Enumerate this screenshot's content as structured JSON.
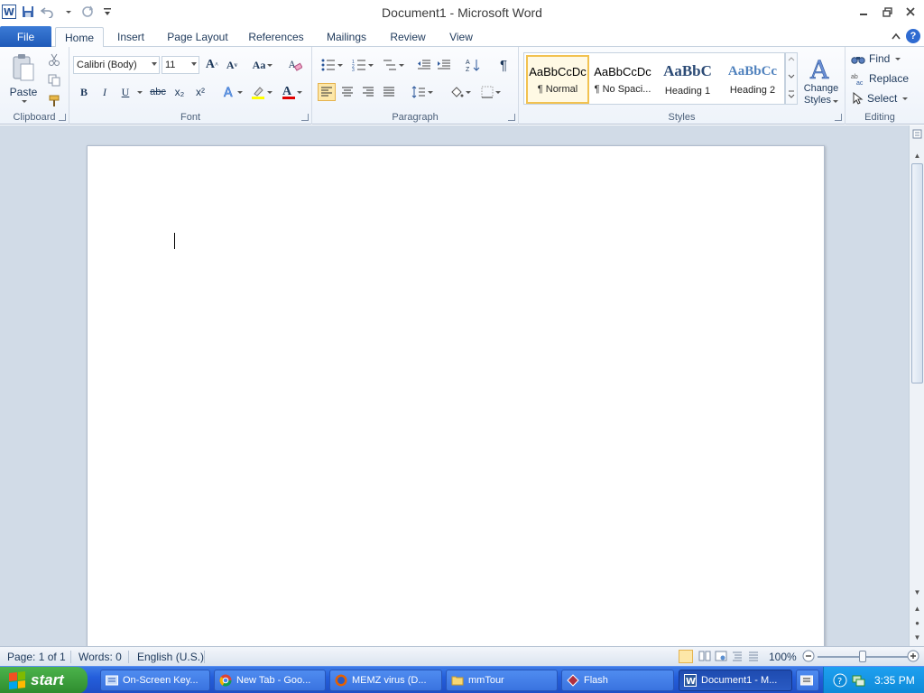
{
  "window": {
    "title": "Document1 - Microsoft Word"
  },
  "qat": {
    "app_icon": "word-icon",
    "save": "save-icon",
    "undo": "undo-icon",
    "redo": "repeat-icon",
    "customize": "qat-dropdown-icon"
  },
  "tabs": {
    "file": "File",
    "items": [
      "Home",
      "Insert",
      "Page Layout",
      "References",
      "Mailings",
      "Review",
      "View"
    ],
    "active": "Home"
  },
  "ribbon": {
    "clipboard": {
      "label": "Clipboard",
      "paste": "Paste"
    },
    "font": {
      "label": "Font",
      "family": "Calibri (Body)",
      "size": "11",
      "case_label": "Aa",
      "bold": "B",
      "italic": "I",
      "underline": "U",
      "strike": "abc",
      "subscript": "x₂",
      "superscript": "x²",
      "font_color_letter": "A"
    },
    "paragraph": {
      "label": "Paragraph",
      "show_marks": "¶"
    },
    "styles": {
      "label": "Styles",
      "items": [
        {
          "preview": "AaBbCcDc",
          "name": "¶ Normal"
        },
        {
          "preview": "AaBbCcDc",
          "name": "¶ No Spaci..."
        },
        {
          "preview": "AaBbC",
          "name": "Heading 1"
        },
        {
          "preview": "AaBbCc",
          "name": "Heading 2"
        }
      ],
      "change_styles_line1": "Change",
      "change_styles_line2": "Styles"
    },
    "editing": {
      "label": "Editing",
      "find": "Find",
      "replace": "Replace",
      "select": "Select"
    }
  },
  "status": {
    "page": "Page: 1 of 1",
    "words": "Words: 0",
    "language": "English (U.S.)",
    "zoom": "100%",
    "zoom_value": 100
  },
  "taskbar": {
    "start": "start",
    "items": [
      {
        "label": "On-Screen Key...",
        "icon": "keyboard-icon"
      },
      {
        "label": "New Tab - Goo...",
        "icon": "chrome-icon"
      },
      {
        "label": "MEMZ virus (D...",
        "icon": "firefox-icon"
      },
      {
        "label": "mmTour",
        "icon": "folder-icon"
      },
      {
        "label": "Flash",
        "icon": "flash-icon"
      },
      {
        "label": "Document1 - M...",
        "icon": "word-icon",
        "active": true
      }
    ],
    "clock": "3:35 PM"
  },
  "colors": {
    "accent": "#2b579a",
    "file_tab": "#2a64c5",
    "taskbar": "#245edb",
    "start": "#3a9a3a",
    "selected_style": "#f2c250"
  }
}
